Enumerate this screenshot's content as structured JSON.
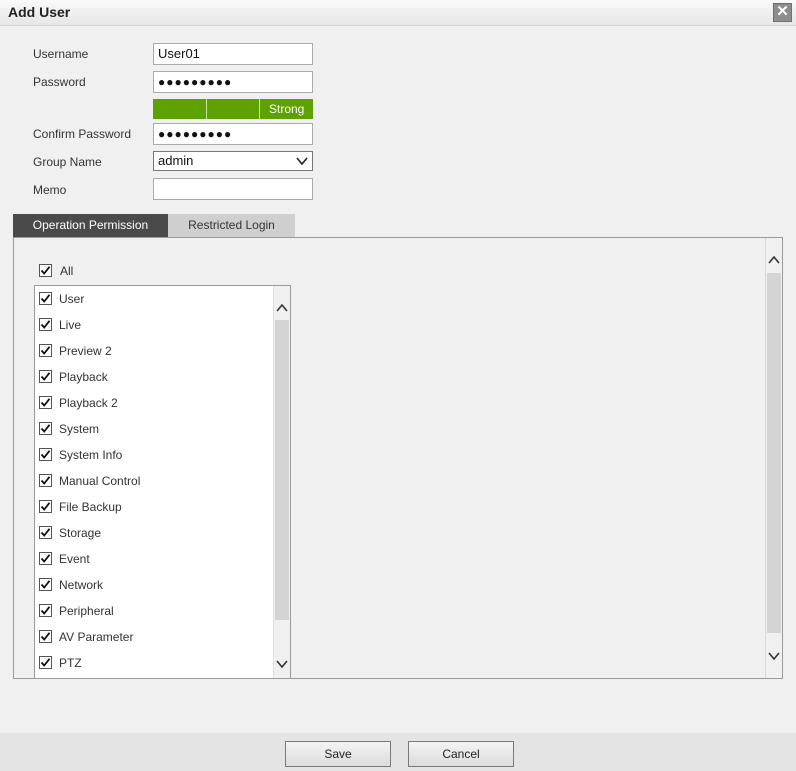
{
  "dialog": {
    "title": "Add User",
    "close_label": "✕"
  },
  "form": {
    "username": {
      "label": "Username",
      "value": "User01"
    },
    "password": {
      "label": "Password",
      "value": "●●●●●●●●●",
      "strength": [
        "",
        "",
        "Strong"
      ]
    },
    "confirm_password": {
      "label": "Confirm Password",
      "value": "●●●●●●●●●"
    },
    "group_name": {
      "label": "Group Name",
      "value": "admin"
    },
    "memo": {
      "label": "Memo",
      "value": ""
    }
  },
  "tabs": [
    {
      "label": "Operation Permission",
      "active": true
    },
    {
      "label": "Restricted Login",
      "active": false
    }
  ],
  "permissions": {
    "all_label": "All",
    "all_checked": true,
    "items": [
      {
        "label": "User",
        "checked": true
      },
      {
        "label": "Live",
        "checked": true
      },
      {
        "label": "Preview 2",
        "checked": true
      },
      {
        "label": "Playback",
        "checked": true
      },
      {
        "label": "Playback 2",
        "checked": true
      },
      {
        "label": "System",
        "checked": true
      },
      {
        "label": "System Info",
        "checked": true
      },
      {
        "label": "Manual Control",
        "checked": true
      },
      {
        "label": "File Backup",
        "checked": true
      },
      {
        "label": "Storage",
        "checked": true
      },
      {
        "label": "Event",
        "checked": true
      },
      {
        "label": "Network",
        "checked": true
      },
      {
        "label": "Peripheral",
        "checked": true
      },
      {
        "label": "AV Parameter",
        "checked": true
      },
      {
        "label": "PTZ",
        "checked": true
      }
    ]
  },
  "buttons": {
    "save": "Save",
    "cancel": "Cancel"
  },
  "colors": {
    "strength_bar": "#5ea200",
    "active_tab": "#4a4a4a",
    "inactive_tab": "#cfcfcf"
  }
}
